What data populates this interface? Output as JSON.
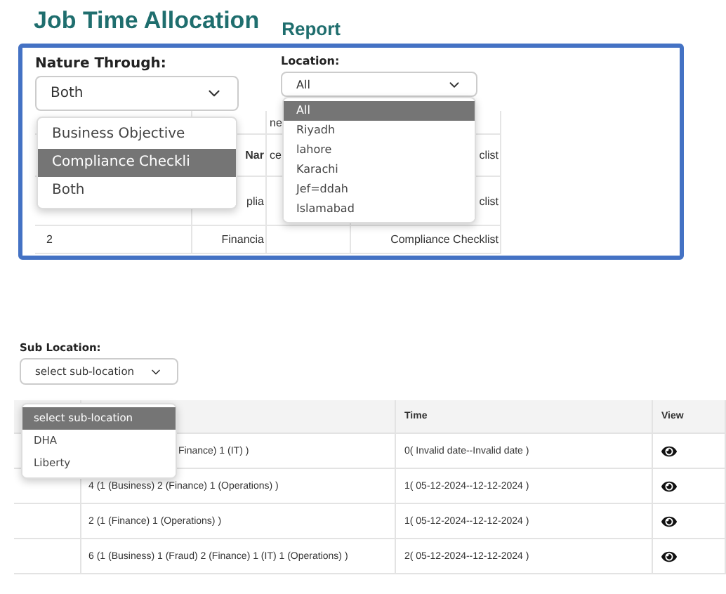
{
  "title": "Job Time Allocation",
  "subtitle": "Report",
  "nature_through": {
    "label": "Nature Through:",
    "value": "Both",
    "options": [
      {
        "label": "Business Objective",
        "highlighted": false
      },
      {
        "label": "Compliance Checkli",
        "highlighted": true
      },
      {
        "label": "Both",
        "highlighted": false
      }
    ]
  },
  "location": {
    "label": "Location:",
    "value": "All",
    "options": [
      {
        "label": "All",
        "selected": true
      },
      {
        "label": "Riyadh",
        "selected": false
      },
      {
        "label": "lahore",
        "selected": false
      },
      {
        "label": "Karachi",
        "selected": false
      },
      {
        "label": "Jef=ddah",
        "selected": false
      },
      {
        "label": "Islamabad",
        "selected": false
      }
    ]
  },
  "background_table": {
    "rows": [
      {
        "column_3": "ne"
      },
      {
        "column_2": "Nar",
        "column_3": "ce",
        "column_4": "clist"
      },
      {
        "column_2": "plia",
        "column_4": "clist"
      },
      {
        "column_1": "2",
        "column_2": "Financia",
        "column_4": "Compliance Checklist"
      }
    ]
  },
  "sub_location": {
    "label": "Sub Location:",
    "value": "select sub-location",
    "options": [
      {
        "label": "select sub-location",
        "selected": true
      },
      {
        "label": "DHA",
        "selected": false
      },
      {
        "label": "Liberty",
        "selected": false
      }
    ]
  },
  "table": {
    "columns": [
      "Time",
      "View"
    ],
    "rows": [
      {
        "column_2": "Finance) 1 (IT) )",
        "covered": true,
        "time": "0( Invalid date--Invalid date )"
      },
      {
        "column_2": "4 (1 (Business) 2 (Finance) 1 (Operations) )",
        "covered": false,
        "time": "1( 05-12-2024--12-12-2024 )"
      },
      {
        "column_2": "2 (1 (Finance) 1 (Operations) )",
        "covered": false,
        "time": "1( 05-12-2024--12-12-2024 )"
      },
      {
        "column_2": "6 (1 (Business) 1 (Fraud) 2 (Finance) 1 (IT) 1 (Operations) )",
        "covered": false,
        "time": "2( 05-12-2024--12-12-2024 )"
      }
    ]
  }
}
